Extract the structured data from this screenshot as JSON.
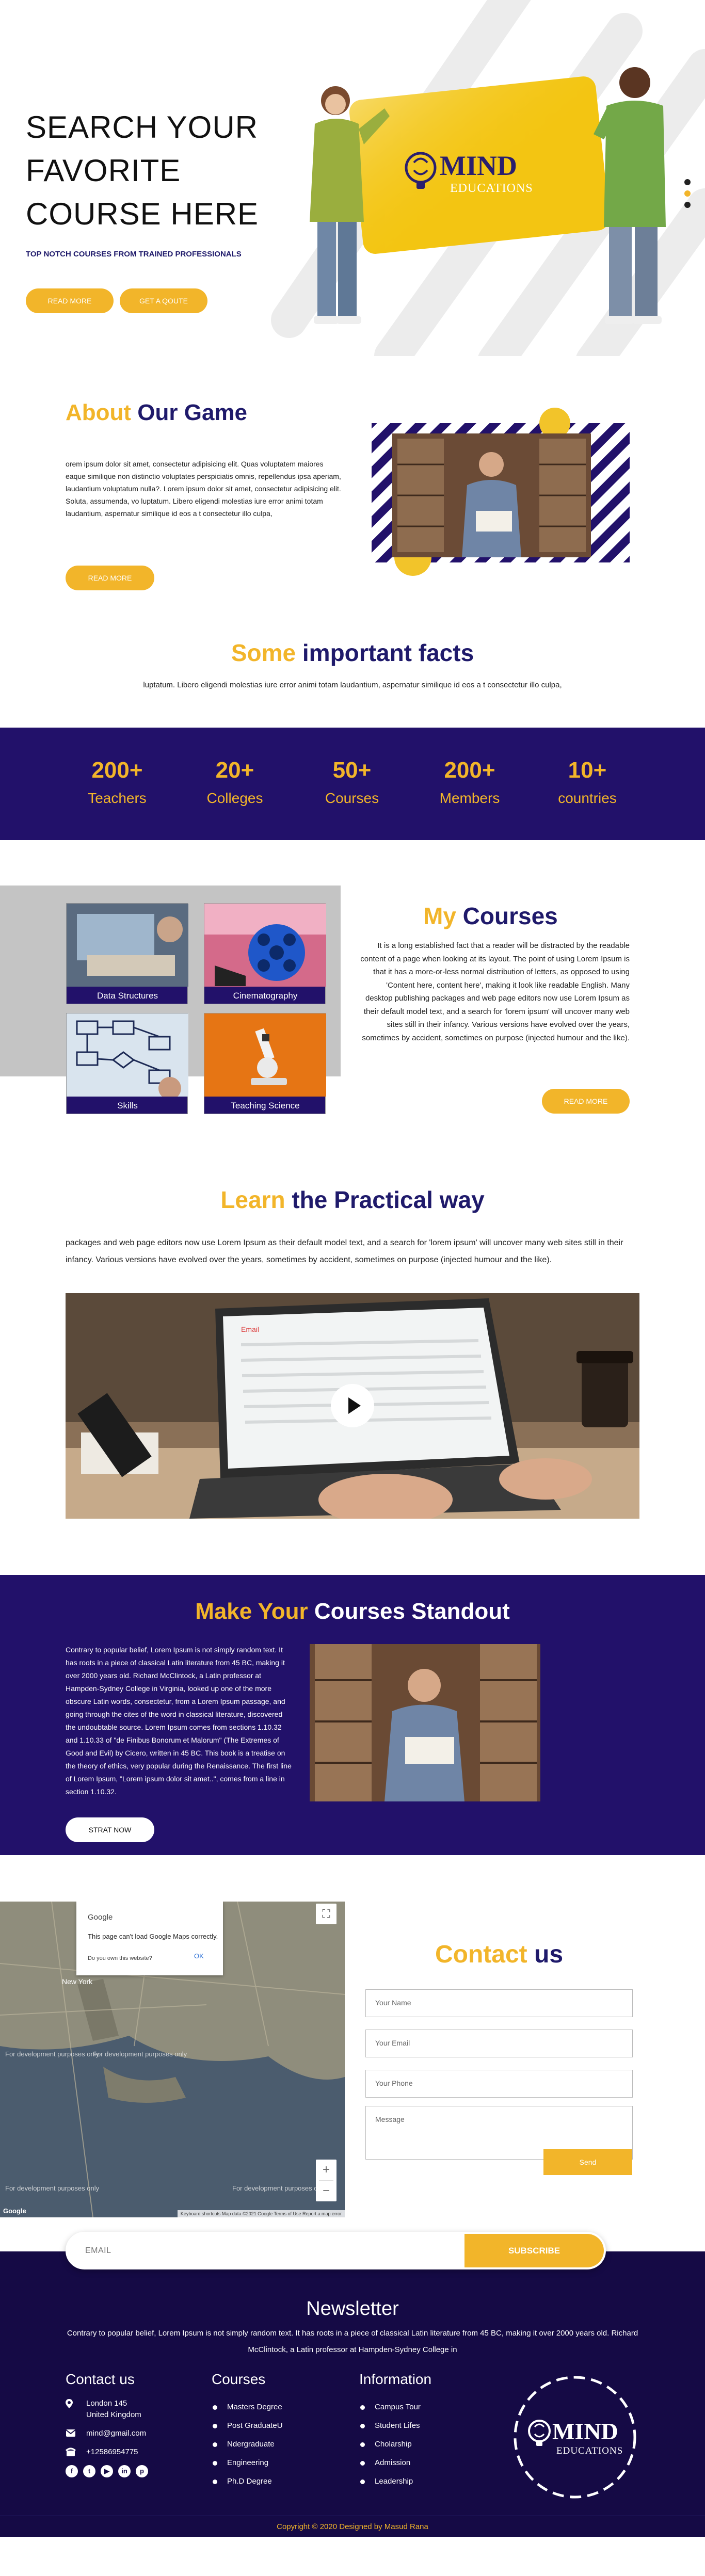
{
  "hero": {
    "title_line1": "SEARCH YOUR",
    "title_line2": "FAVORITE",
    "title_line3": "COURSE HERE",
    "subtitle": "TOP NOTCH COURSES FROM TRAINED PROFESSIONALS",
    "read_more": "READ MORE",
    "get_quote": "GET A QOUTE",
    "logo_main": "MIND",
    "logo_sub": "EDUCATIONS"
  },
  "about": {
    "title_a": "About",
    "title_b": " Our Game",
    "text": "orem ipsum dolor sit amet, consectetur adipisicing elit. Quas voluptatem maiores eaque similique non distinctio voluptates perspiciatis omnis, repellendus ipsa aperiam, laudantium voluptatum nulla?. Lorem ipsum dolor sit amet, consectetur adipisicing elit. Soluta, assumenda, vo luptatum. Libero eligendi molestias iure error animi totam laudantium, aspernatur similique id eos a t consectetur illo culpa,",
    "button": "READ MORE"
  },
  "facts": {
    "title_a": "Some",
    "title_b": " important facts",
    "text": "luptatum. Libero eligendi molestias iure error animi totam laudantium, aspernatur similique id eos a t consectetur illo culpa,",
    "stats": [
      {
        "value": "200+",
        "label": "Teachers"
      },
      {
        "value": "20+",
        "label": "Colleges"
      },
      {
        "value": "50+",
        "label": "Courses"
      },
      {
        "value": "200+",
        "label": "Members"
      },
      {
        "value": "10+",
        "label": "countries"
      }
    ]
  },
  "courses": {
    "title_a": "My",
    "title_b": " Courses",
    "cards": [
      {
        "label": "Data Structures"
      },
      {
        "label": "Cinematography"
      },
      {
        "label": "Skills"
      },
      {
        "label": "Teaching Science"
      }
    ],
    "text": "It is a long established fact that a reader will be distracted by the readable content of a page when looking at its layout. The point of using Lorem Ipsum is that it has a more-or-less normal distribution of letters, as opposed to using 'Content here, content here', making it look like readable English. Many desktop publishing packages and web page editors now use Lorem Ipsum as their default model text, and a search for 'lorem ipsum' will uncover many web sites still in their infancy. Various versions have evolved over the years, sometimes by accident, sometimes on purpose (injected humour and the like).",
    "button": "READ MORE"
  },
  "learn": {
    "title_a": "Learn",
    "title_b": " the Practical way",
    "text": "packages and web page editors now use Lorem Ipsum as their default model text, and a search for 'lorem ipsum' will uncover many web sites still in their infancy. Various versions have evolved over the years, sometimes by accident, sometimes on purpose (injected humour and the like).",
    "screen_label": "Email"
  },
  "standout": {
    "title_a": "Make Your",
    "title_b": " Courses Standout",
    "text": "Contrary to popular belief, Lorem Ipsum is not simply random text. It has roots in a piece of classical Latin literature from 45 BC, making it over 2000 years old. Richard McClintock, a Latin professor at Hampden-Sydney College in Virginia, looked up one of the more obscure Latin words, consectetur, from a Lorem Ipsum passage, and going through the cites of the word in classical literature, discovered the undoubtable source. Lorem Ipsum comes from sections 1.10.32 and 1.10.33 of \"de Finibus Bonorum et Malorum\" (The Extremes of Good and Evil) by Cicero, written in 45 BC. This book is a treatise on the theory of ethics, very popular during the Renaissance. The first line of Lorem Ipsum, \"Lorem ipsum dolor sit amet..\", comes from a line in section 1.10.32.",
    "button": "STRAT NOW"
  },
  "map": {
    "google": "Google",
    "error": "This page can't load Google Maps correctly.",
    "question": "Do you own this website?",
    "ok": "OK",
    "city": "New York",
    "dev_text": "For development purposes only",
    "footer_bits": "Keyboard shortcuts   Map data ©2021 Google   Terms of Use   Report a map error"
  },
  "contact": {
    "title_a": "Contact",
    "title_b": " us",
    "name_ph": "Your Name",
    "email_ph": "Your Email",
    "phone_ph": "Your Phone",
    "message_ph": "Message",
    "send": "Send"
  },
  "newsletter": {
    "email_ph": "EMAIL",
    "subscribe": "SUBSCRIBE",
    "title": "Newsletter",
    "text": "Contrary to popular belief, Lorem Ipsum is not simply random text. It has roots in a piece of classical Latin literature from 45 BC, making it over 2000 years old. Richard McClintock, a Latin professor at Hampden-Sydney College in"
  },
  "footer": {
    "contact_title": "Contact us",
    "address_line1": "London 145",
    "address_line2": "United Kingdom",
    "email": "mind@gmail.com",
    "phone": "+12586954775",
    "courses_title": "Courses",
    "courses": [
      "Masters Degree",
      "Post GraduateU",
      "Ndergraduate",
      "Engineering",
      "Ph.D Degree"
    ],
    "info_title": "Information",
    "info": [
      "Campus Tour",
      "Student Lifes",
      "Cholarship",
      "Admission",
      "Leadership"
    ],
    "logo_main": "MIND",
    "logo_sub": "EDUCATIONS",
    "copyright": "Copyright © 2020 Designed by Masud Rana"
  }
}
